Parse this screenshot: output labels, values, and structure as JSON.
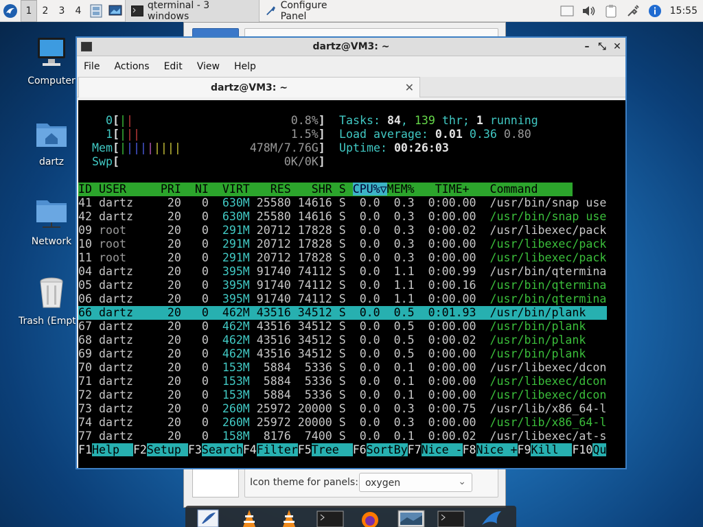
{
  "taskbar": {
    "workspaces": [
      "1",
      "2",
      "3",
      "4"
    ],
    "tasks": [
      {
        "label": "qterminal - 3 windows",
        "active": true
      },
      {
        "label": "Configure Panel",
        "active": false
      }
    ],
    "clock": "15:55"
  },
  "desktop": {
    "icons": [
      {
        "label": "Computer"
      },
      {
        "label": "dartz"
      },
      {
        "label": "Network"
      },
      {
        "label": "Trash (Empty)"
      }
    ]
  },
  "configure_panel": {
    "icon_theme_label": "Icon theme for panels:",
    "icon_theme_value": "oxygen"
  },
  "qterminal": {
    "title": "dartz@VM3: ~",
    "menu": [
      "File",
      "Actions",
      "Edit",
      "View",
      "Help"
    ],
    "tab_title": "dartz@VM3: ~"
  },
  "htop": {
    "meters": [
      {
        "label": "0",
        "value": "0.8%"
      },
      {
        "label": "1",
        "value": "1.5%"
      },
      {
        "label": "Mem",
        "value": "478M/7.76G"
      },
      {
        "label": "Swp",
        "value": "0K/0K"
      }
    ],
    "tasks_label": "Tasks:",
    "tasks": "84",
    "threads": "139",
    "thr_label": "thr;",
    "running": "1",
    "running_label": "running",
    "load_label": "Load average:",
    "load": [
      "0.01",
      "0.36",
      "0.80"
    ],
    "uptime_label": "Uptime:",
    "uptime": "00:26:03",
    "columns": [
      "ID",
      "USER",
      "PRI",
      "NI",
      "VIRT",
      "RES",
      "SHR",
      "S",
      "CPU%▽",
      "MEM%",
      "TIME+",
      "Command"
    ],
    "processes": [
      {
        "id": "41",
        "user": "dartz",
        "pri": "20",
        "ni": "0",
        "virt": "630M",
        "res": "25580",
        "shr": "14616",
        "s": "S",
        "cpu": "0.0",
        "mem": "0.3",
        "time": "0:00.00",
        "cmd": "/usr/bin/snap use",
        "root": false,
        "thread": false
      },
      {
        "id": "42",
        "user": "dartz",
        "pri": "20",
        "ni": "0",
        "virt": "630M",
        "res": "25580",
        "shr": "14616",
        "s": "S",
        "cpu": "0.0",
        "mem": "0.3",
        "time": "0:00.00",
        "cmd": "/usr/bin/snap use",
        "root": false,
        "thread": true
      },
      {
        "id": "09",
        "user": "root",
        "pri": "20",
        "ni": "0",
        "virt": "291M",
        "res": "20712",
        "shr": "17828",
        "s": "S",
        "cpu": "0.0",
        "mem": "0.3",
        "time": "0:00.02",
        "cmd": "/usr/libexec/pack",
        "root": true,
        "thread": false
      },
      {
        "id": "10",
        "user": "root",
        "pri": "20",
        "ni": "0",
        "virt": "291M",
        "res": "20712",
        "shr": "17828",
        "s": "S",
        "cpu": "0.0",
        "mem": "0.3",
        "time": "0:00.00",
        "cmd": "/usr/libexec/pack",
        "root": true,
        "thread": true
      },
      {
        "id": "11",
        "user": "root",
        "pri": "20",
        "ni": "0",
        "virt": "291M",
        "res": "20712",
        "shr": "17828",
        "s": "S",
        "cpu": "0.0",
        "mem": "0.3",
        "time": "0:00.00",
        "cmd": "/usr/libexec/pack",
        "root": true,
        "thread": true
      },
      {
        "id": "04",
        "user": "dartz",
        "pri": "20",
        "ni": "0",
        "virt": "395M",
        "res": "91740",
        "shr": "74112",
        "s": "S",
        "cpu": "0.0",
        "mem": "1.1",
        "time": "0:00.99",
        "cmd": "/usr/bin/qtermina",
        "root": false,
        "thread": false
      },
      {
        "id": "05",
        "user": "dartz",
        "pri": "20",
        "ni": "0",
        "virt": "395M",
        "res": "91740",
        "shr": "74112",
        "s": "S",
        "cpu": "0.0",
        "mem": "1.1",
        "time": "0:00.16",
        "cmd": "/usr/bin/qtermina",
        "root": false,
        "thread": true
      },
      {
        "id": "06",
        "user": "dartz",
        "pri": "20",
        "ni": "0",
        "virt": "395M",
        "res": "91740",
        "shr": "74112",
        "s": "S",
        "cpu": "0.0",
        "mem": "1.1",
        "time": "0:00.00",
        "cmd": "/usr/bin/qtermina",
        "root": false,
        "thread": true
      },
      {
        "id": "66",
        "user": "dartz",
        "pri": "20",
        "ni": "0",
        "virt": "462M",
        "res": "43516",
        "shr": "34512",
        "s": "S",
        "cpu": "0.0",
        "mem": "0.5",
        "time": "0:01.93",
        "cmd": "/usr/bin/plank",
        "root": false,
        "thread": false,
        "selected": true
      },
      {
        "id": "67",
        "user": "dartz",
        "pri": "20",
        "ni": "0",
        "virt": "462M",
        "res": "43516",
        "shr": "34512",
        "s": "S",
        "cpu": "0.0",
        "mem": "0.5",
        "time": "0:00.00",
        "cmd": "/usr/bin/plank",
        "root": false,
        "thread": true
      },
      {
        "id": "68",
        "user": "dartz",
        "pri": "20",
        "ni": "0",
        "virt": "462M",
        "res": "43516",
        "shr": "34512",
        "s": "S",
        "cpu": "0.0",
        "mem": "0.5",
        "time": "0:00.02",
        "cmd": "/usr/bin/plank",
        "root": false,
        "thread": true
      },
      {
        "id": "69",
        "user": "dartz",
        "pri": "20",
        "ni": "0",
        "virt": "462M",
        "res": "43516",
        "shr": "34512",
        "s": "S",
        "cpu": "0.0",
        "mem": "0.5",
        "time": "0:00.00",
        "cmd": "/usr/bin/plank",
        "root": false,
        "thread": true
      },
      {
        "id": "70",
        "user": "dartz",
        "pri": "20",
        "ni": "0",
        "virt": "153M",
        "res": "5884",
        "shr": "5336",
        "s": "S",
        "cpu": "0.0",
        "mem": "0.1",
        "time": "0:00.00",
        "cmd": "/usr/libexec/dcon",
        "root": false,
        "thread": false
      },
      {
        "id": "71",
        "user": "dartz",
        "pri": "20",
        "ni": "0",
        "virt": "153M",
        "res": "5884",
        "shr": "5336",
        "s": "S",
        "cpu": "0.0",
        "mem": "0.1",
        "time": "0:00.00",
        "cmd": "/usr/libexec/dcon",
        "root": false,
        "thread": true
      },
      {
        "id": "72",
        "user": "dartz",
        "pri": "20",
        "ni": "0",
        "virt": "153M",
        "res": "5884",
        "shr": "5336",
        "s": "S",
        "cpu": "0.0",
        "mem": "0.1",
        "time": "0:00.00",
        "cmd": "/usr/libexec/dcon",
        "root": false,
        "thread": true
      },
      {
        "id": "73",
        "user": "dartz",
        "pri": "20",
        "ni": "0",
        "virt": "260M",
        "res": "25972",
        "shr": "20000",
        "s": "S",
        "cpu": "0.0",
        "mem": "0.3",
        "time": "0:00.75",
        "cmd": "/usr/lib/x86_64-l",
        "root": false,
        "thread": false
      },
      {
        "id": "74",
        "user": "dartz",
        "pri": "20",
        "ni": "0",
        "virt": "260M",
        "res": "25972",
        "shr": "20000",
        "s": "S",
        "cpu": "0.0",
        "mem": "0.3",
        "time": "0:00.00",
        "cmd": "/usr/lib/x86_64-l",
        "root": false,
        "thread": true
      },
      {
        "id": "77",
        "user": "dartz",
        "pri": "20",
        "ni": "0",
        "virt": "158M",
        "res": "8176",
        "shr": "7400",
        "s": "S",
        "cpu": "0.0",
        "mem": "0.1",
        "time": "0:00.02",
        "cmd": "/usr/libexec/at-s",
        "root": false,
        "thread": false
      }
    ],
    "fkeys": [
      {
        "key": "F1",
        "label": "Help  "
      },
      {
        "key": "F2",
        "label": "Setup "
      },
      {
        "key": "F3",
        "label": "Search"
      },
      {
        "key": "F4",
        "label": "Filter"
      },
      {
        "key": "F5",
        "label": "Tree  "
      },
      {
        "key": "F6",
        "label": "SortBy"
      },
      {
        "key": "F7",
        "label": "Nice -"
      },
      {
        "key": "F8",
        "label": "Nice +"
      },
      {
        "key": "F9",
        "label": "Kill  "
      },
      {
        "key": "F10",
        "label": "Qu"
      }
    ]
  },
  "colors": {
    "accent": "#3d7fc4",
    "header_bg": "#2ca52c",
    "selection_bg": "#27b0b0"
  }
}
